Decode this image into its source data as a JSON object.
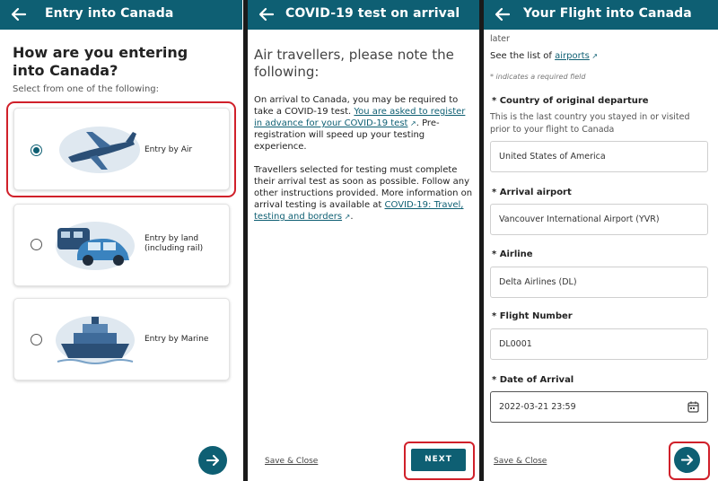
{
  "screen1": {
    "title": "Entry into Canada",
    "heading": "How are you entering into Canada?",
    "subheading": "Select from one of the following:",
    "options": [
      {
        "label": "Entry by Air",
        "selected": true,
        "icon": "airplane-illustration"
      },
      {
        "label_line1": "Entry by land",
        "label_line2": "(including rail)",
        "selected": false,
        "icon": "car-train-illustration"
      },
      {
        "label": "Entry by Marine",
        "selected": false,
        "icon": "ship-illustration"
      }
    ],
    "next_icon": "arrow-right-icon"
  },
  "screen2": {
    "title": "COVID-19 test on arrival",
    "heading": "Air travellers, please note the following:",
    "para1_a": "On arrival to Canada, you may be required to take a COVID-19 test. ",
    "para1_link": "You are asked to register in advance for your COVID-19 test",
    "para1_b": ". Pre-registration will speed up your testing experience.",
    "para2_a": "Travellers selected for testing must complete their arrival test as soon as possible. Follow any other instructions provided. More information on arrival testing is available at ",
    "para2_link": "COVID-19: Travel, testing and borders",
    "para2_b": ".",
    "save_close": "Save & Close",
    "next_label": "NEXT"
  },
  "screen3": {
    "title": "Your Flight into Canada",
    "cut_text": "later",
    "airports_prefix": "See the list of ",
    "airports_link": "airports",
    "required_note": "* indicates a required field",
    "fields": [
      {
        "label": "Country of original departure",
        "value": "United States of America"
      },
      {
        "label": "Arrival airport",
        "value": "Vancouver International Airport (YVR)"
      },
      {
        "label": "Airline",
        "value": "Delta Airlines (DL)"
      },
      {
        "label": "Flight Number",
        "value": "DL0001"
      },
      {
        "label": "Date of Arrival",
        "value": "2022-03-21 23:59"
      }
    ],
    "country_help": "This is the last country you stayed in or visited prior to your flight to Canada",
    "save_close": "Save & Close",
    "next_icon": "arrow-right-icon"
  },
  "colors": {
    "primary": "#0e5f73",
    "highlight": "#d0202a"
  }
}
